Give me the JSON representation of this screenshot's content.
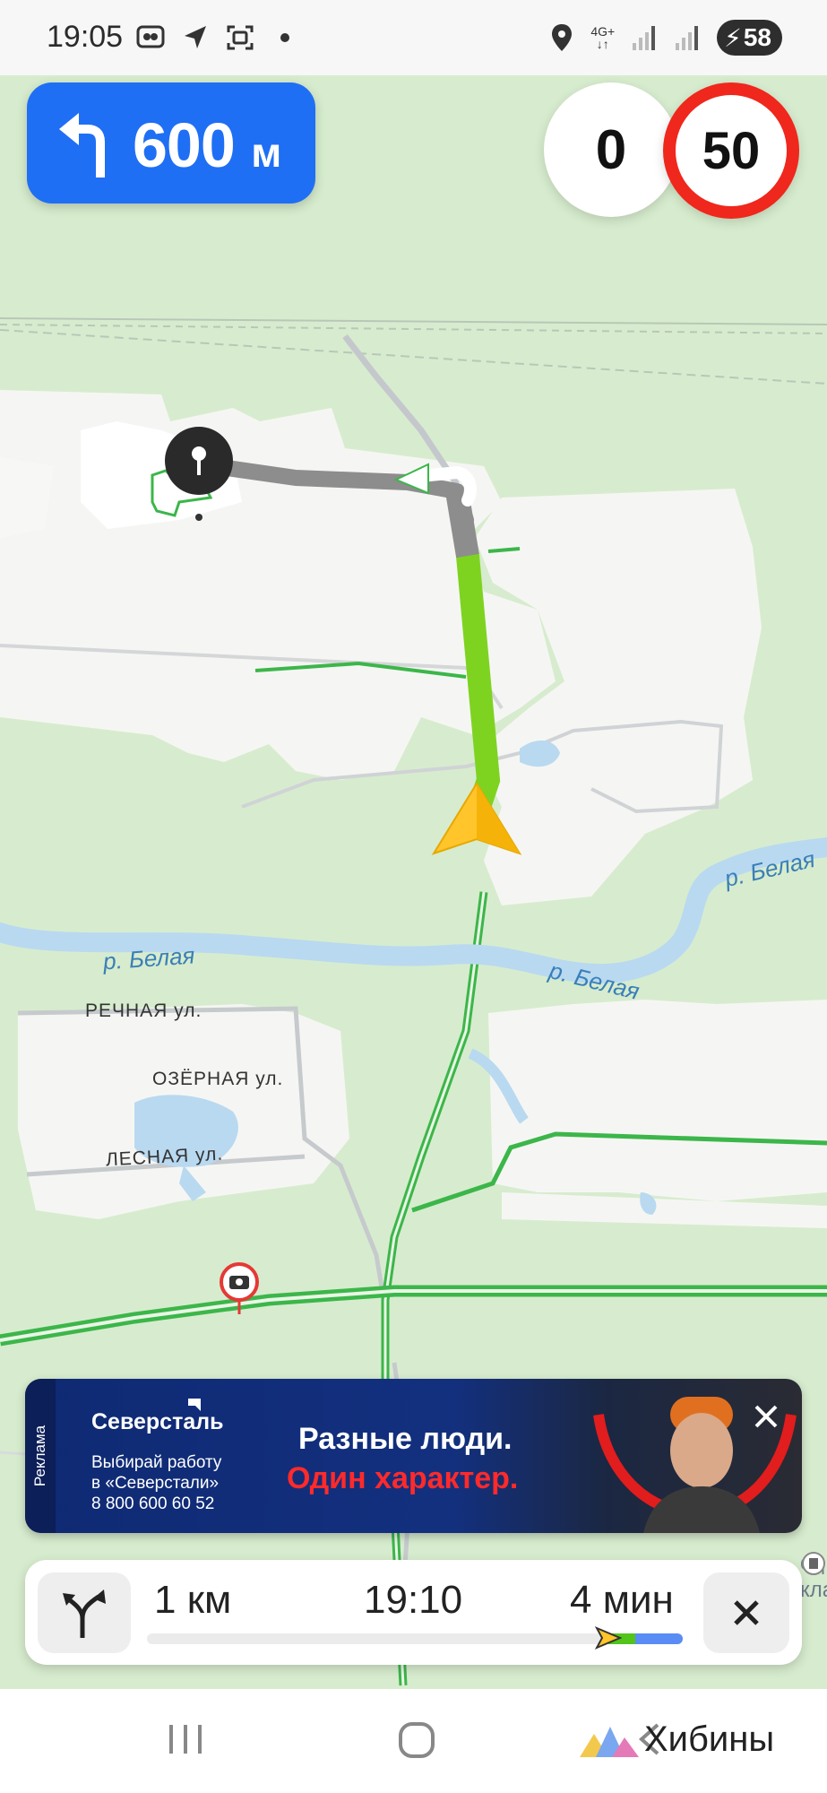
{
  "status_bar": {
    "time": "19:05",
    "network": "4G+",
    "battery": "58",
    "icons_left": [
      "chat-icon",
      "navigation-arrow-icon",
      "screenshot-icon",
      "dot-icon"
    ],
    "icons_right": [
      "location-pin-icon",
      "network-icon",
      "signal-icon",
      "signal-icon",
      "battery-charging-icon"
    ]
  },
  "navigation": {
    "maneuver": "turn-left",
    "distance_value": "600",
    "distance_unit": "м"
  },
  "speed": {
    "current": "0",
    "limit": "50",
    "limit_color": "#f0271c"
  },
  "map_labels": {
    "river1": "р. Белая",
    "river2": "р. Белая",
    "river3": "р. Белая",
    "street1": "РЕЧНАЯ ул.",
    "street2": "ОЗЁРНАЯ ул.",
    "street3": "ЛЕСНАЯ ул.",
    "poi_edge_line1": "од",
    "poi_edge_line2": "кладб"
  },
  "ad": {
    "tag": "Реклама",
    "brand": "Северсталь",
    "text_line1": "Выбирай работу",
    "text_line2": "в «Северстали»",
    "text_line3": "8 800 600 60 52",
    "headline1": "Разные люди.",
    "headline2": "Один характер."
  },
  "route": {
    "distance": "1 км",
    "arrival": "19:10",
    "duration": "4 мин",
    "progress": 0.86
  },
  "watermark": "Хибины",
  "colors": {
    "primary_blue": "#1f6ff5",
    "route_green": "#7ed321",
    "traffic_green": "#3cb64a",
    "accent_red": "#f0271c"
  }
}
